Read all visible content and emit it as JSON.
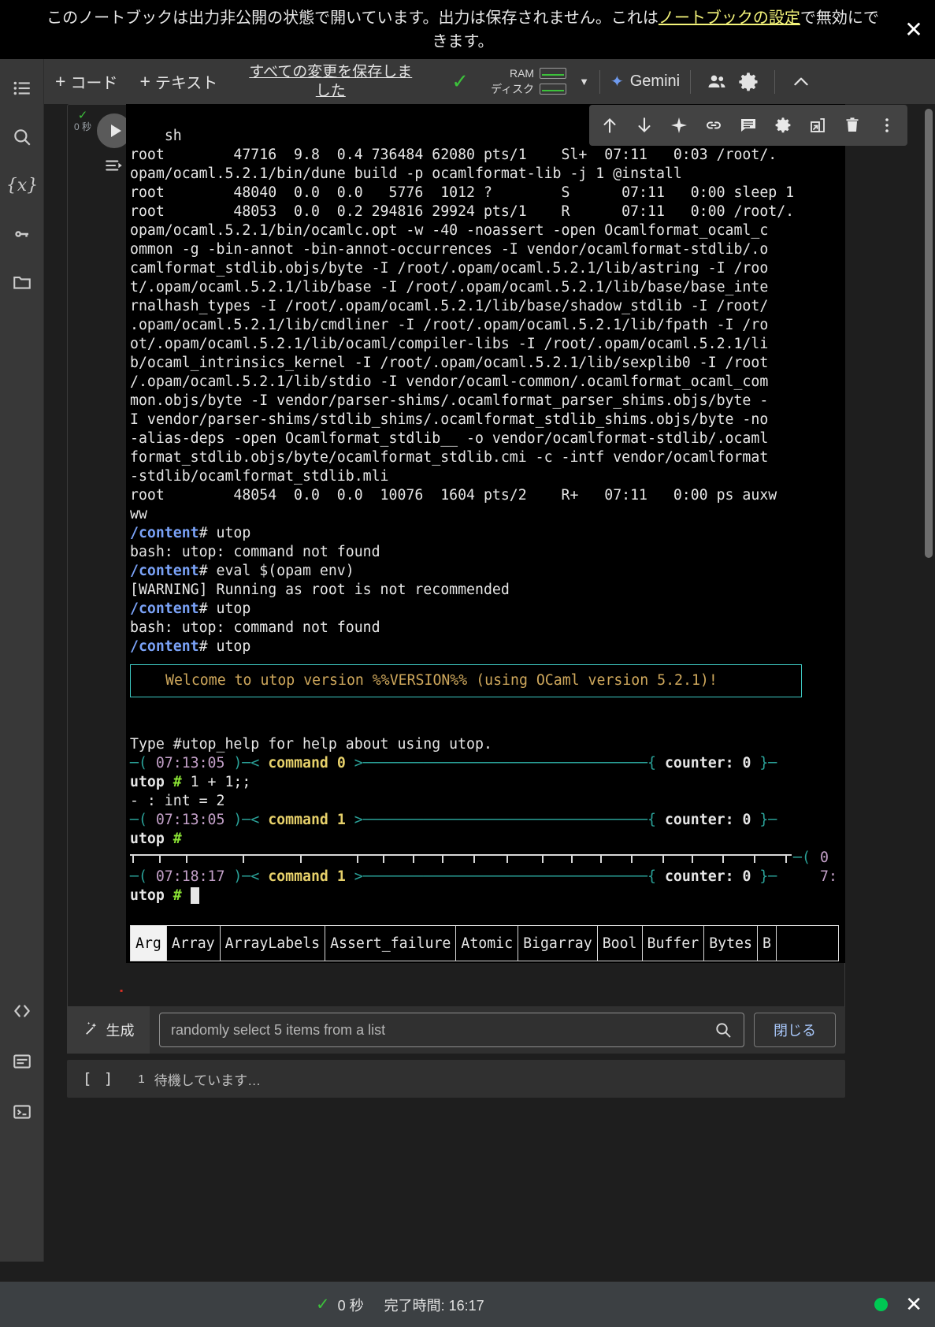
{
  "notice": {
    "text_before": "このノートブックは出力非公開の状態で開いています。出力は保存されません。これは",
    "link_text": "ノートブックの設定",
    "text_after": "で無効にできます。",
    "close_icon": "close-icon"
  },
  "left_rail": {
    "items": [
      {
        "name": "toc-icon",
        "label": "目次"
      },
      {
        "name": "search-icon",
        "label": "検索"
      },
      {
        "name": "variables-icon",
        "label": "変数"
      },
      {
        "name": "secrets-key-icon",
        "label": "シークレット"
      },
      {
        "name": "files-folder-icon",
        "label": "ファイル"
      },
      {
        "name": "code-snippets-icon",
        "label": "コード スニペット"
      },
      {
        "name": "command-palette-icon",
        "label": "コマンド パレット"
      },
      {
        "name": "terminal-icon",
        "label": "ターミナル"
      }
    ]
  },
  "toolbar": {
    "add_code_label": "コード",
    "add_text_label": "テキスト",
    "plus": "+",
    "save_status": "すべての変更を保存しました",
    "check_icon": "checkmark-icon",
    "ram_label": "RAM",
    "disk_label": "ディスク",
    "caret_icon": "chevron-down-icon",
    "gemini_label": "Gemini",
    "share_icon": "share-people-icon",
    "settings_icon": "gear-icon",
    "collapse_icon": "chevron-up-icon"
  },
  "output_toolbar": {
    "icons": [
      {
        "name": "move-cell-up-icon",
        "glyph": "↑"
      },
      {
        "name": "move-cell-down-icon",
        "glyph": "↓"
      },
      {
        "name": "gemini-sparkle-icon",
        "glyph": "✦"
      },
      {
        "name": "link-icon",
        "glyph": "🔗"
      },
      {
        "name": "comment-icon",
        "glyph": "▤"
      },
      {
        "name": "cell-settings-gear-icon",
        "glyph": "⚙"
      },
      {
        "name": "open-in-new-tab-icon",
        "glyph": "⧉"
      },
      {
        "name": "delete-cell-trash-icon",
        "glyph": "🗑"
      },
      {
        "name": "more-options-icon",
        "glyph": "⋮"
      }
    ]
  },
  "cell": {
    "run_seconds": "0 秒",
    "run_check": "✓",
    "run_button_icon": "run-play-icon",
    "scroll_output_icon": "scroll-to-output-icon"
  },
  "terminal": {
    "lines": [
      {
        "t": "plain",
        "s": "sh"
      },
      {
        "t": "plain",
        "s": "root        47716  9.8  0.4 736484 62080 pts/1    Sl+  07:11   0:03 /root/."
      },
      {
        "t": "plain",
        "s": "opam/ocaml.5.2.1/bin/dune build -p ocamlformat-lib -j 1 @install"
      },
      {
        "t": "plain",
        "s": "root        48040  0.0  0.0   5776  1012 ?        S      07:11   0:00 sleep 1"
      },
      {
        "t": "plain",
        "s": "root        48053  0.0  0.2 294816 29924 pts/1    R      07:11   0:00 /root/."
      },
      {
        "t": "plain",
        "s": "opam/ocaml.5.2.1/bin/ocamlc.opt -w -40 -noassert -open Ocamlformat_ocaml_c"
      },
      {
        "t": "plain",
        "s": "ommon -g -bin-annot -bin-annot-occurrences -I vendor/ocamlformat-stdlib/.o"
      },
      {
        "t": "plain",
        "s": "camlformat_stdlib.objs/byte -I /root/.opam/ocaml.5.2.1/lib/astring -I /roo"
      },
      {
        "t": "plain",
        "s": "t/.opam/ocaml.5.2.1/lib/base -I /root/.opam/ocaml.5.2.1/lib/base/base_inte"
      },
      {
        "t": "plain",
        "s": "rnalhash_types -I /root/.opam/ocaml.5.2.1/lib/base/shadow_stdlib -I /root/"
      },
      {
        "t": "plain",
        "s": ".opam/ocaml.5.2.1/lib/cmdliner -I /root/.opam/ocaml.5.2.1/lib/fpath -I /ro"
      },
      {
        "t": "plain",
        "s": "ot/.opam/ocaml.5.2.1/lib/ocaml/compiler-libs -I /root/.opam/ocaml.5.2.1/li"
      },
      {
        "t": "plain",
        "s": "b/ocaml_intrinsics_kernel -I /root/.opam/ocaml.5.2.1/lib/sexplib0 -I /root"
      },
      {
        "t": "plain",
        "s": "/.opam/ocaml.5.2.1/lib/stdio -I vendor/ocaml-common/.ocamlformat_ocaml_com"
      },
      {
        "t": "plain",
        "s": "mon.objs/byte -I vendor/parser-shims/.ocamlformat_parser_shims.objs/byte -"
      },
      {
        "t": "plain",
        "s": "I vendor/parser-shims/stdlib_shims/.ocamlformat_stdlib_shims.objs/byte -no"
      },
      {
        "t": "plain",
        "s": "-alias-deps -open Ocamlformat_stdlib__ -o vendor/ocamlformat-stdlib/.ocaml"
      },
      {
        "t": "plain",
        "s": "format_stdlib.objs/byte/ocamlformat_stdlib.cmi -c -intf vendor/ocamlformat"
      },
      {
        "t": "plain",
        "s": "-stdlib/ocamlformat_stdlib.mli"
      },
      {
        "t": "plain",
        "s": "root        48054  0.0  0.0  10076  1604 pts/2    R+   07:11   0:00 ps auxw"
      },
      {
        "t": "plain",
        "s": "ww"
      },
      {
        "t": "prompt",
        "path": "/content",
        "hash": "# ",
        "cmd": "utop"
      },
      {
        "t": "plain",
        "s": "bash: utop: command not found"
      },
      {
        "t": "prompt",
        "path": "/content",
        "hash": "# ",
        "cmd": "eval $(opam env)"
      },
      {
        "t": "plain",
        "s": "[WARNING] Running as root is not recommended"
      },
      {
        "t": "prompt",
        "path": "/content",
        "hash": "# ",
        "cmd": "utop"
      },
      {
        "t": "plain",
        "s": "bash: utop: command not found"
      },
      {
        "t": "prompt",
        "path": "/content",
        "hash": "# ",
        "cmd": "utop"
      }
    ],
    "banner": "Welcome to utop version %%VERSION%% (using OCaml version 5.2.1)!",
    "help_line": "Type #utop_help for help about using utop.",
    "commands": [
      {
        "time": "07:13:05",
        "label": "command 0",
        "counter": "counter: 0",
        "prompt": "utop # ",
        "input": "1 + 1;;",
        "result": "- : int = 2"
      },
      {
        "time": "07:13:05",
        "label": "command 1",
        "counter": "counter: 0",
        "prompt": "utop # ",
        "input": "",
        "result": ""
      },
      {
        "time": "07:18:17",
        "label": "command 1",
        "counter": "counter: 0",
        "prompt": "utop # ",
        "input": "",
        "result": ""
      }
    ],
    "partial_right_label": "-( 07:",
    "completions": [
      "Arg",
      "Array",
      "ArrayLabels",
      "Assert_failure",
      "Atomic",
      "Bigarray",
      "Bool",
      "Buffer",
      "Bytes",
      "B"
    ],
    "selected_completion": "Arg",
    "colors": {
      "prompt_path": "#7aa2f7",
      "banner_text": "#cfa85c",
      "banner_border": "#3ec9c3",
      "command_label": "#e6d06a",
      "time_label": "#c3a0c8",
      "rule": "#2aa198",
      "hash": "#8ae234"
    }
  },
  "generate_bar": {
    "label": "生成",
    "magic_icon": "magic-wand-icon",
    "input_value": "randomly select 5 items from a list",
    "input_placeholder": "randomly select 5 items from a list",
    "search_icon": "search-icon",
    "close_label": "閉じる"
  },
  "next_cell": {
    "brackets": "[  ]",
    "index": "1",
    "status": "待機しています…"
  },
  "statusbar": {
    "check_icon": "checkmark-icon",
    "seconds": "0 秒",
    "completed_label": "完了時間: 16:17",
    "connected_dot": "connected-status-dot",
    "close_icon": "close-icon"
  }
}
